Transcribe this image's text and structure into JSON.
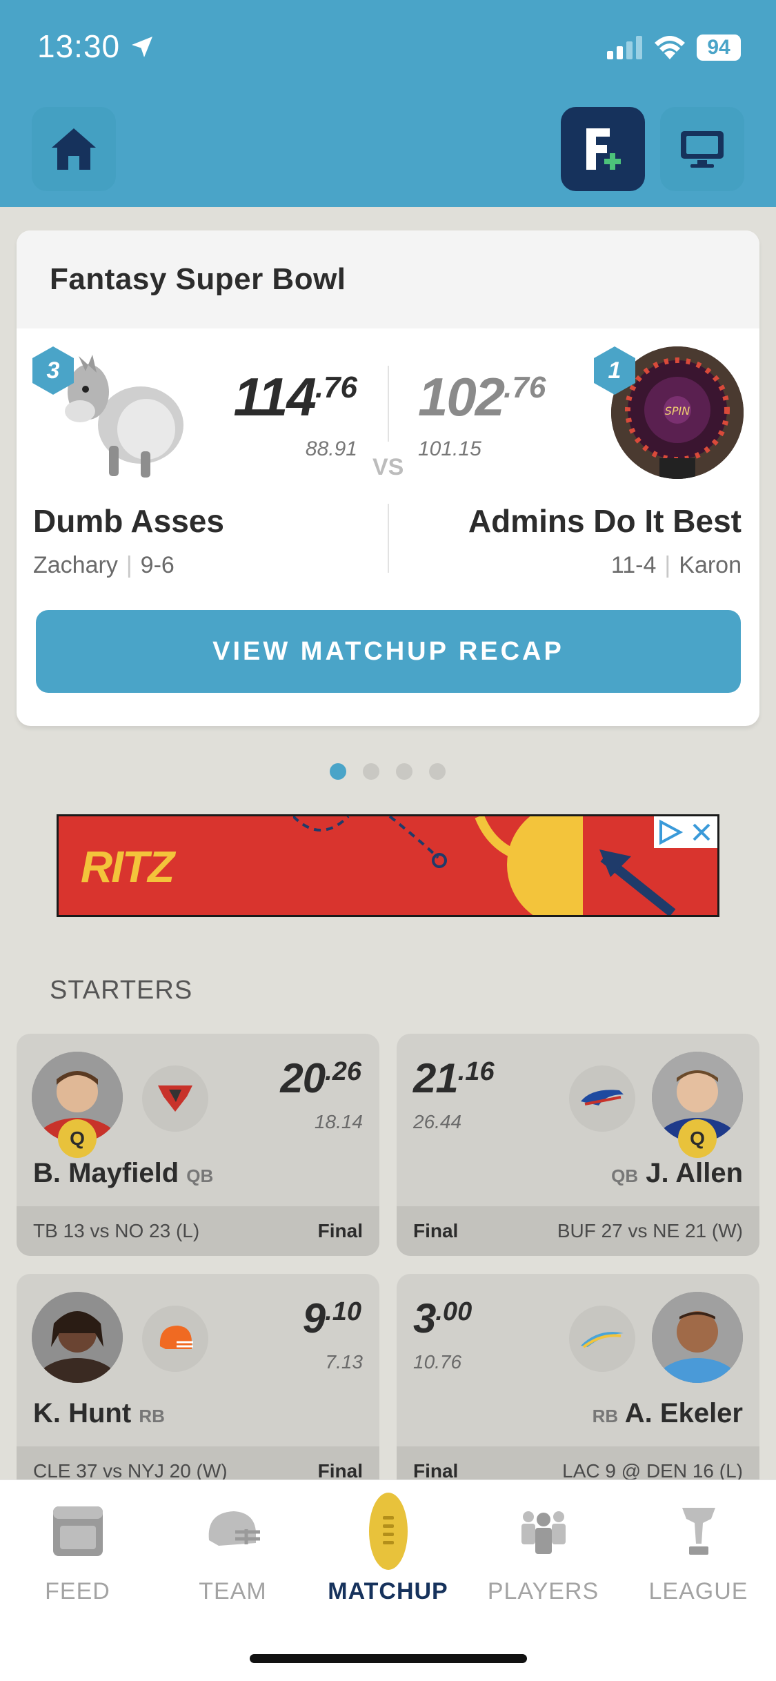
{
  "status_bar": {
    "time": "13:30",
    "battery": "94"
  },
  "matchup": {
    "title": "Fantasy Super Bowl",
    "vs_label": "VS",
    "left": {
      "seed": "3",
      "score_int": "114",
      "score_dec": ".76",
      "projected": "88.91",
      "team": "Dumb Asses",
      "owner": "Zachary",
      "record": "9-6"
    },
    "right": {
      "seed": "1",
      "score_int": "102",
      "score_dec": ".76",
      "projected": "101.15",
      "team": "Admins Do It Best",
      "owner": "Karon",
      "record": "11-4"
    },
    "recap_button": "VIEW MATCHUP RECAP"
  },
  "ad": {
    "brand": "RITZ"
  },
  "starters": {
    "title": "STARTERS",
    "players": [
      {
        "name": "B. Mayfield",
        "pos": "QB",
        "badge": "Q",
        "score_int": "20",
        "score_dec": ".26",
        "projected": "18.14",
        "game": "TB 13 vs NO 23 (L)",
        "status": "Final"
      },
      {
        "name": "J. Allen",
        "pos": "QB",
        "badge": "Q",
        "score_int": "21",
        "score_dec": ".16",
        "projected": "26.44",
        "game": "BUF 27 vs NE 21 (W)",
        "status": "Final"
      },
      {
        "name": "K. Hunt",
        "pos": "RB",
        "score_int": "9",
        "score_dec": ".10",
        "projected": "7.13",
        "game": "CLE 37 vs NYJ 20 (W)",
        "status": "Final"
      },
      {
        "name": "A. Ekeler",
        "pos": "RB",
        "score_int": "3",
        "score_dec": ".00",
        "projected": "10.76",
        "game": "LAC 9 @ DEN 16 (L)",
        "status": "Final"
      }
    ]
  },
  "tabs": [
    {
      "label": "FEED",
      "icon": "feed-icon"
    },
    {
      "label": "TEAM",
      "icon": "helmet-icon"
    },
    {
      "label": "MATCHUP",
      "icon": "football-icon",
      "active": true
    },
    {
      "label": "PLAYERS",
      "icon": "players-icon"
    },
    {
      "label": "LEAGUE",
      "icon": "trophy-icon"
    }
  ],
  "colors": {
    "header": "#4aa4c8",
    "navy": "#16325c",
    "badge_yellow": "#e8c23b",
    "background": "#e0dfd9"
  }
}
